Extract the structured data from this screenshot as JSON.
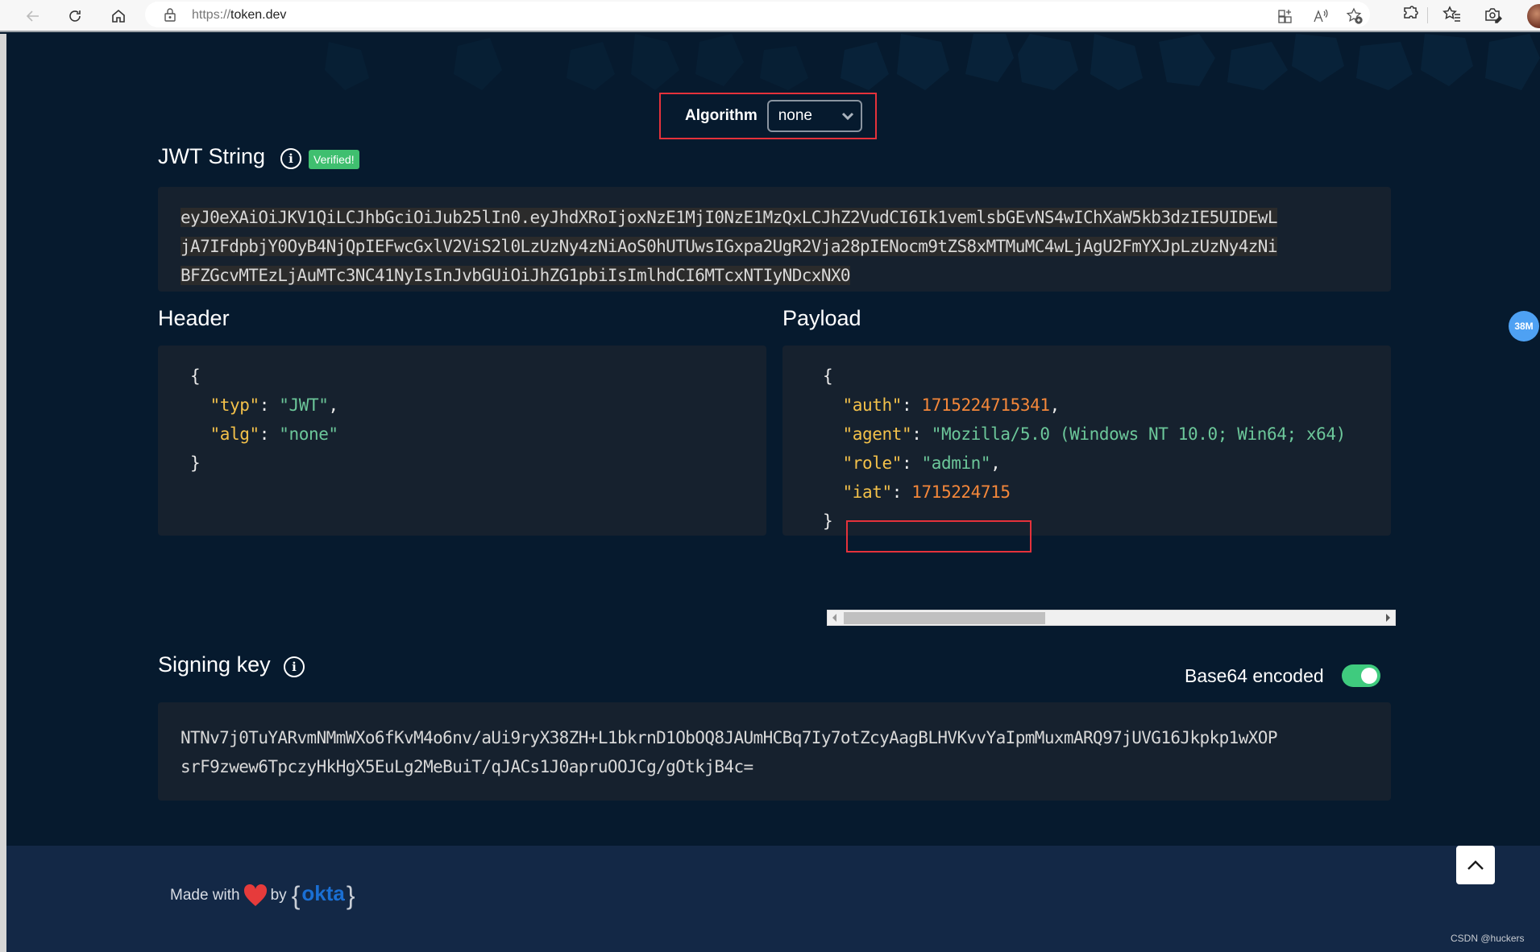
{
  "browser": {
    "url_scheme": "https://",
    "url_host": "token.dev"
  },
  "algorithm": {
    "label": "Algorithm",
    "selected": "none"
  },
  "jwt": {
    "title": "JWT String",
    "badge": "Verified!",
    "lines": [
      "eyJ0eXAiOiJKV1QiLCJhbGciOiJub25lIn0.eyJhdXRoIjoxNzE1MjI0NzE1MzQxLCJhZ2VudCI6Ik1vemlsbGEvNS4wIChXaW5kb3dzIE5UIDEwL",
      "jA7IFdpbjY0OyB4NjQpIEFwcGxlV2ViS2l0LzUzNy4zNiAoS0hUTUwsIGxpa2UgR2Vja28pIENocm9tZS8xMTMuMC4wLjAgU2FmYXJpLzUzNy4zNi",
      "BFZGcvMTEzLjAuMTc3NC41NyIsInJvbGUiOiJhZG1pbiIsImlhdCI6MTcxNTIyNDcxNX0"
    ]
  },
  "header_section": {
    "title": "Header",
    "fields": [
      {
        "key": "\"typ\"",
        "value": "\"JWT\"",
        "type": "string",
        "comma": true
      },
      {
        "key": "\"alg\"",
        "value": "\"none\"",
        "type": "string",
        "comma": false
      }
    ]
  },
  "payload_section": {
    "title": "Payload",
    "fields": [
      {
        "key": "\"auth\"",
        "value": "1715224715341",
        "type": "number",
        "comma": true
      },
      {
        "key": "\"agent\"",
        "value": "\"Mozilla/5.0 (Windows NT 10.0; Win64; x64)",
        "type": "string",
        "comma": false
      },
      {
        "key": "\"role\"",
        "value": "\"admin\"",
        "type": "string",
        "comma": true
      },
      {
        "key": "\"iat\"",
        "value": "1715224715",
        "type": "number",
        "comma": false
      }
    ],
    "scroll_position_fraction": 0.0
  },
  "signing_key": {
    "title": "Signing key",
    "base64_label": "Base64 encoded",
    "base64_enabled": true,
    "lines": [
      "NTNv7j0TuYARvmNMmWXo6fKvM4o6nv/aUi9ryX38ZH+L1bkrnD1ObOQ8JAUmHCBq7Iy7otZcyAagBLHVKvvYaIpmMuxmARQ97jUVG16Jkpkp1wXOP",
      "srF9zwew6TpczyHkHgX5EuLg2MeBuiT/qJACs1J0apruOOJCg/gOtkjB4c="
    ]
  },
  "footer": {
    "made_with": "Made with",
    "by": "by",
    "brand": "okta",
    "watermark": "CSDN @huckers"
  },
  "side_badge": "38M",
  "colors": {
    "page_bg": "#061a2e",
    "panel_bg": "#16212e",
    "highlight_border": "#e5323b",
    "verified_green": "#3fbf6f",
    "json_key": "#f3c14a",
    "json_string": "#6cc79a",
    "json_number": "#f4873a",
    "okta_blue": "#1a6fd4"
  }
}
